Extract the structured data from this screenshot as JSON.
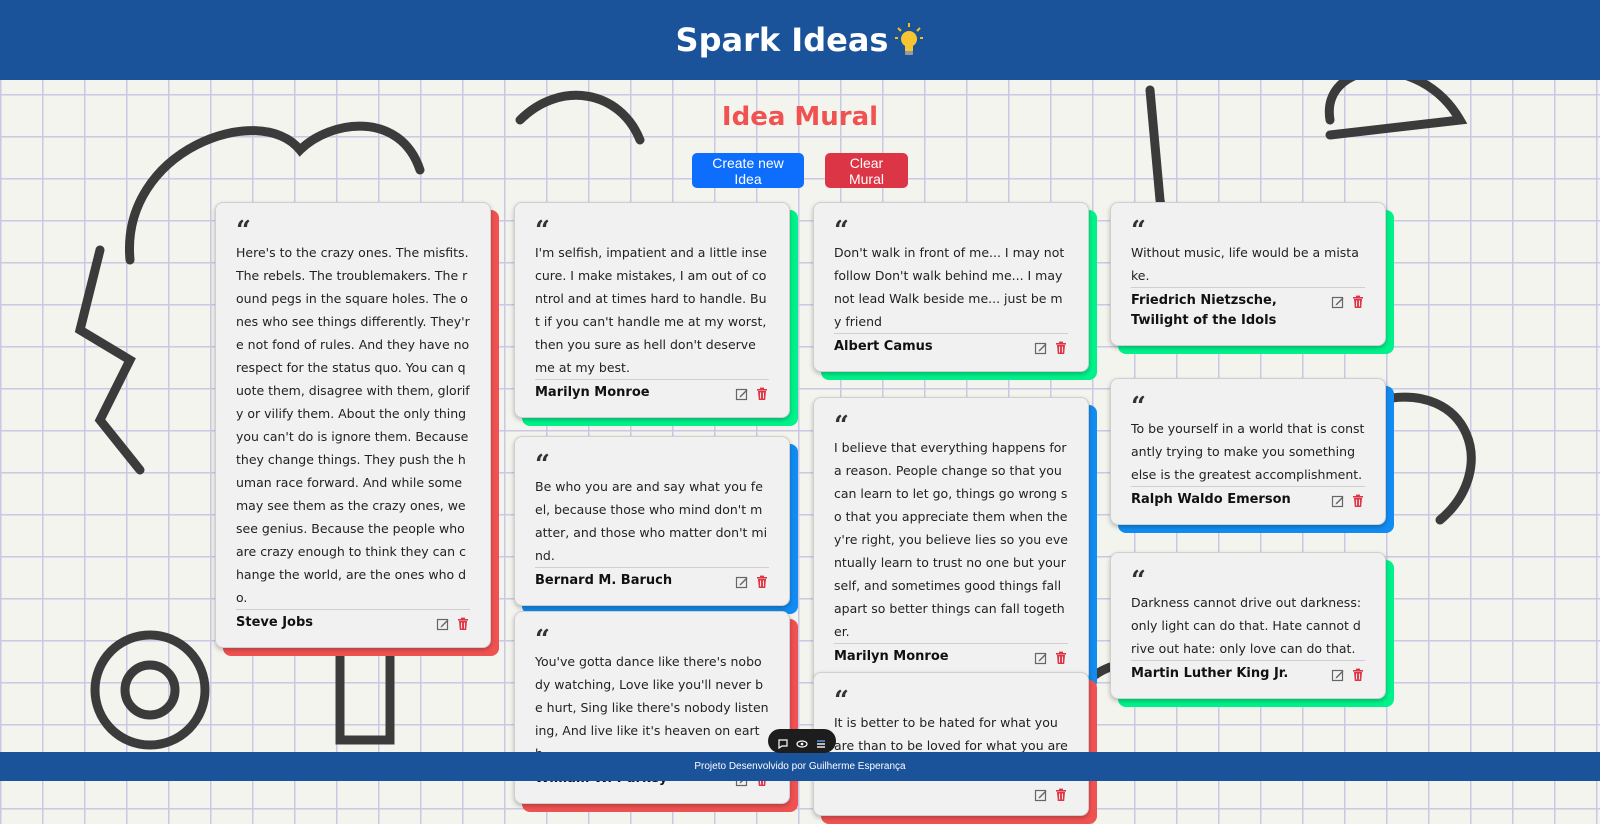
{
  "app": {
    "title": "Spark Ideas",
    "icon": "lightbulb-icon"
  },
  "page": {
    "subtitle": "Idea Mural"
  },
  "actions": {
    "create_label": "Create new Idea",
    "clear_label": "Clear Mural"
  },
  "colors": {
    "header": "#1b539b",
    "red": "#f05252",
    "green": "#00f28a",
    "blue": "#118cf2",
    "subtitle": "#f05252"
  },
  "cards": [
    {
      "quote": "Here's to the crazy ones. The misfits. The rebels. The troublemakers. The round pegs in the square holes. The ones who see things differently. They're not fond of rules. And they have no respect for the status quo. You can quote them, disagree with them, glorify or vilify them. About the only thing you can't do is ignore them. Because they change things. They push the human race forward. And while some may see them as the crazy ones, we see genius. Because the people who are crazy enough to think they can change the world, are the ones who do.",
      "author": "Steve Jobs",
      "color": "red"
    },
    {
      "quote": "I'm selfish, impatient and a little insecure. I make mistakes, I am out of control and at times hard to handle. But if you can't handle me at my worst, then you sure as hell don't deserve me at my best.",
      "author": "Marilyn Monroe",
      "color": "green"
    },
    {
      "quote": "Be who you are and say what you feel, because those who mind don't matter, and those who matter don't mind.",
      "author": "Bernard M. Baruch",
      "color": "blue"
    },
    {
      "quote": "You've gotta dance like there's nobody watching, Love like you'll never be hurt, Sing like there's nobody listening, And live like it's heaven on earth.",
      "author": "William W. Purkey",
      "color": "red"
    },
    {
      "quote": "Don't walk in front of me... I may not follow Don't walk behind me... I may not lead Walk beside me... just be my friend",
      "author": "Albert Camus",
      "color": "green"
    },
    {
      "quote": "I believe that everything happens for a reason. People change so that you can learn to let go, things go wrong so that you appreciate them when they're right, you believe lies so you eventually learn to trust no one but yourself, and sometimes good things fall apart so better things can fall together.",
      "author": "Marilyn Monroe",
      "color": "blue"
    },
    {
      "quote": "It is better to be hated for what you are than to be loved for what you are not.",
      "author": "",
      "color": "red"
    },
    {
      "quote": "Without music, life would be a mistake.",
      "author": "Friedrich Nietzsche, Twilight of the Idols",
      "color": "green"
    },
    {
      "quote": "To be yourself in a world that is constantly trying to make you something else is the greatest accomplishment.",
      "author": "Ralph Waldo Emerson",
      "color": "blue"
    },
    {
      "quote": "Darkness cannot drive out darkness: only light can do that. Hate cannot drive out hate: only love can do that.",
      "author": "Martin Luther King Jr.",
      "color": "green"
    }
  ],
  "footer": {
    "text": "Projeto Desenvolvido por Guilherme Esperança"
  }
}
